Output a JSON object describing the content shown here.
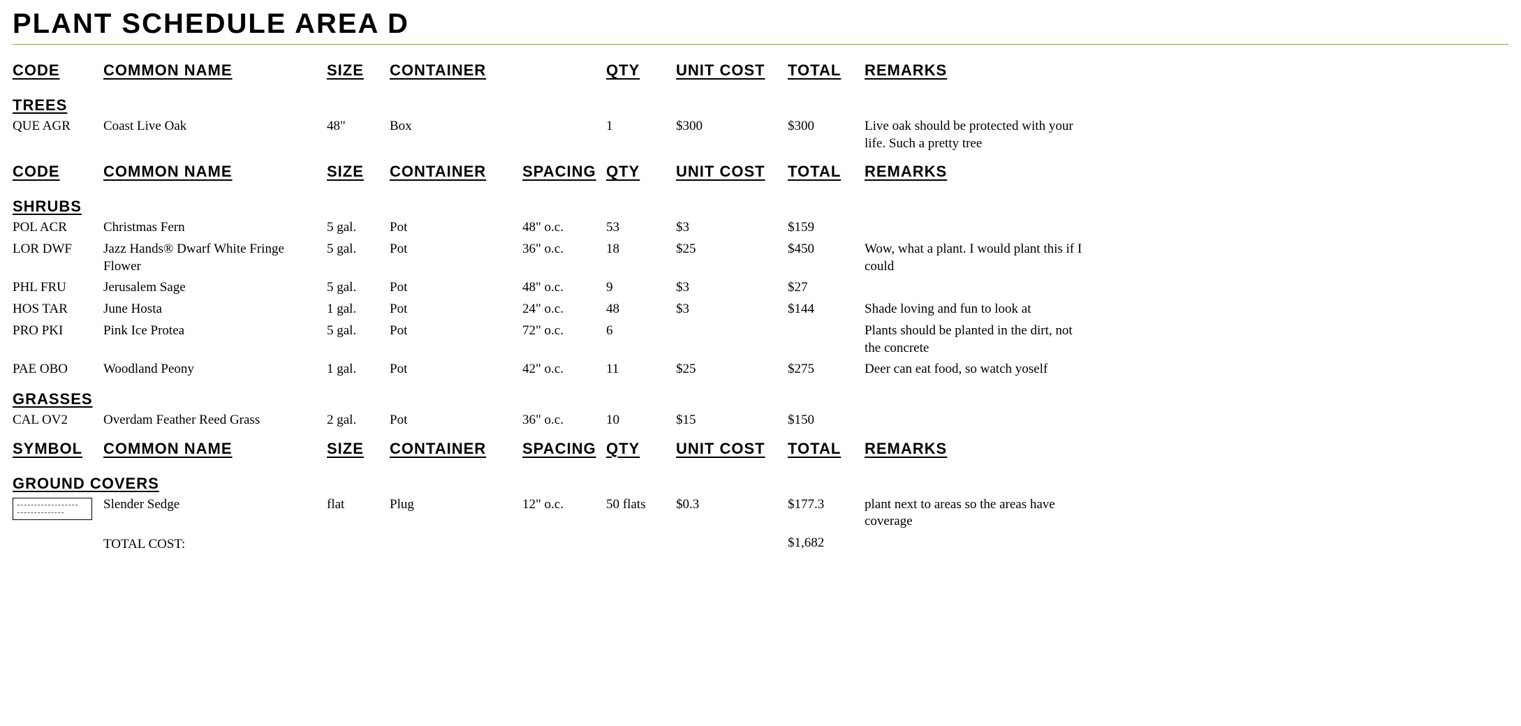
{
  "title": "PLANT SCHEDULE AREA D",
  "headers1": {
    "code": "CODE",
    "name": "COMMON NAME",
    "size": "SIZE",
    "container": "CONTAINER",
    "spacing": "",
    "qty": "QTY",
    "unit": "UNIT COST",
    "total": "TOTAL",
    "remarks": "REMARKS"
  },
  "headers2": {
    "code": "CODE",
    "name": "COMMON NAME",
    "size": "SIZE",
    "container": "CONTAINER",
    "spacing": "SPACING",
    "qty": "QTY",
    "unit": "UNIT COST",
    "total": "TOTAL",
    "remarks": "REMARKS"
  },
  "headers3": {
    "code": "SYMBOL",
    "name": "COMMON NAME",
    "size": "SIZE",
    "container": "CONTAINER",
    "spacing": "SPACING",
    "qty": "QTY",
    "unit": "UNIT COST",
    "total": "TOTAL",
    "remarks": "REMARKS"
  },
  "cat_trees": "TREES",
  "trees": [
    {
      "code": "QUE AGR",
      "name": "Coast Live Oak",
      "size": "48\"",
      "container": "Box",
      "spacing": "",
      "qty": "1",
      "unit": "$300",
      "total": "$300",
      "remarks": "Live oak should be protected with your life. Such a pretty tree"
    }
  ],
  "cat_shrubs": "SHRUBS",
  "shrubs": [
    {
      "code": "POL ACR",
      "name": "Christmas Fern",
      "size": "5 gal.",
      "container": "Pot",
      "spacing": "48\" o.c.",
      "qty": "53",
      "unit": "$3",
      "total": "$159",
      "remarks": ""
    },
    {
      "code": "LOR DWF",
      "name": "Jazz Hands® Dwarf White Fringe Flower",
      "size": "5 gal.",
      "container": "Pot",
      "spacing": "36\" o.c.",
      "qty": "18",
      "unit": "$25",
      "total": "$450",
      "remarks": "Wow, what a plant. I would plant this if I could"
    },
    {
      "code": "PHL FRU",
      "name": "Jerusalem Sage",
      "size": "5 gal.",
      "container": "Pot",
      "spacing": "48\" o.c.",
      "qty": "9",
      "unit": "$3",
      "total": "$27",
      "remarks": ""
    },
    {
      "code": "HOS TAR",
      "name": "June Hosta",
      "size": "1 gal.",
      "container": "Pot",
      "spacing": "24\" o.c.",
      "qty": "48",
      "unit": "$3",
      "total": "$144",
      "remarks": "Shade loving and fun to look at"
    },
    {
      "code": "PRO PKI",
      "name": "Pink Ice Protea",
      "size": "5 gal.",
      "container": "Pot",
      "spacing": "72\" o.c.",
      "qty": "6",
      "unit": "",
      "total": "",
      "remarks": "Plants should be planted in the dirt, not the concrete"
    },
    {
      "code": "PAE OBO",
      "name": "Woodland Peony",
      "size": "1 gal.",
      "container": "Pot",
      "spacing": "42\" o.c.",
      "qty": "11",
      "unit": "$25",
      "total": "$275",
      "remarks": "Deer can eat food, so watch yoself"
    }
  ],
  "cat_grasses": "GRASSES",
  "grasses": [
    {
      "code": "CAL OV2",
      "name": "Overdam Feather Reed Grass",
      "size": "2 gal.",
      "container": "Pot",
      "spacing": "36\" o.c.",
      "qty": "10",
      "unit": "$15",
      "total": "$150",
      "remarks": ""
    }
  ],
  "cat_ground": "GROUND COVERS",
  "ground": [
    {
      "name": "Slender Sedge",
      "size": "flat",
      "container": "Plug",
      "spacing": "12\" o.c.",
      "qty": "50 flats",
      "unit": "$0.3",
      "total": "$177.3",
      "remarks": "plant next to areas so the areas have coverage"
    }
  ],
  "total_label": "TOTAL COST:",
  "total_value": "$1,682"
}
